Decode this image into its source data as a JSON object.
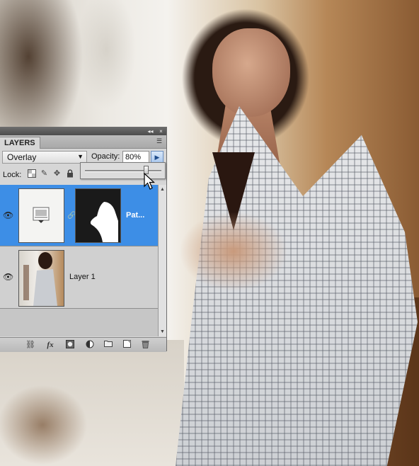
{
  "panel": {
    "tab_label": "LAYERS",
    "collapse_icon": "◂◂",
    "close_icon": "×",
    "menu_icon": "☰",
    "blend_mode": "Overlay",
    "opacity_label": "Opacity:",
    "opacity_value": "80%",
    "opacity_slider_fraction": 0.8,
    "lock_label": "Lock:"
  },
  "layers": [
    {
      "name": "Pat...",
      "selected": true,
      "visible": true,
      "has_mask": true
    },
    {
      "name": "Layer 1",
      "selected": false,
      "visible": true,
      "has_mask": false
    }
  ],
  "bottom_icons": [
    "link-icon",
    "fx-icon",
    "add-mask-icon",
    "adjustment-layer-icon",
    "new-group-icon",
    "new-layer-icon",
    "trash-icon"
  ],
  "colors": {
    "selection": "#3d8ee6",
    "panel": "#d6d6d6"
  }
}
